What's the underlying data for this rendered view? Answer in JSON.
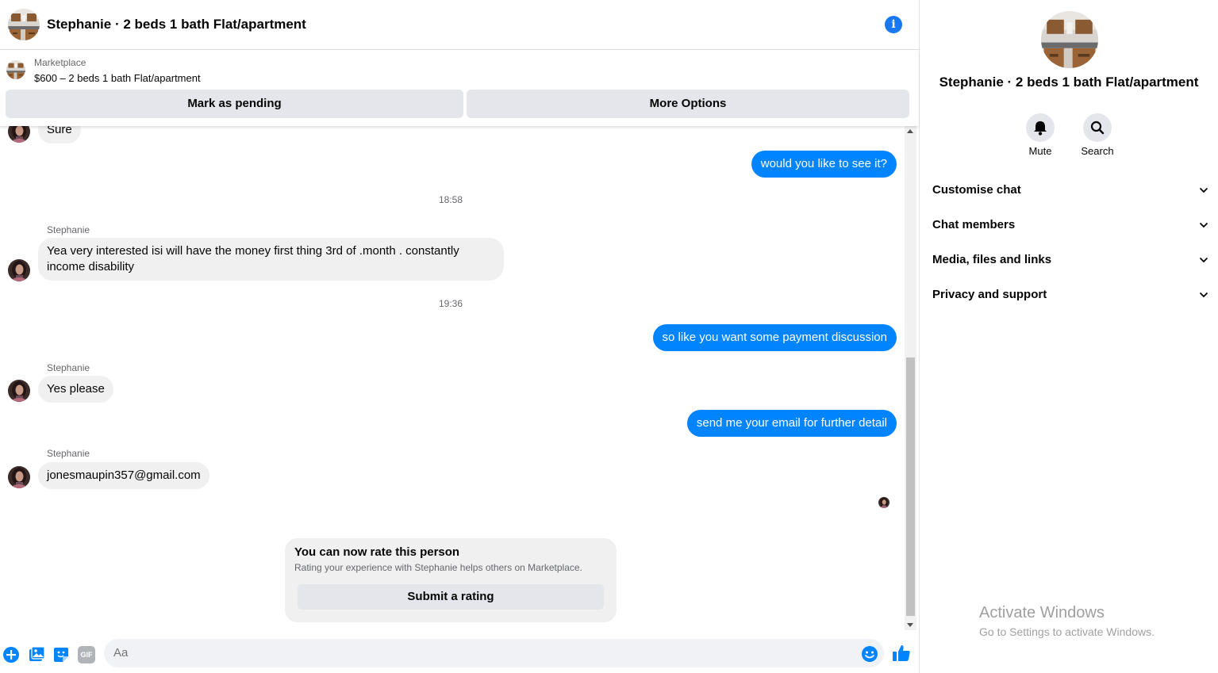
{
  "header": {
    "title": "Stephanie · 2 beds 1 bath Flat/apartment",
    "info_icon": "info-icon"
  },
  "listing": {
    "category": "Marketplace",
    "price_line": "$600 – 2 beds 1 bath Flat/apartment",
    "mark_pending_label": "Mark as pending",
    "more_options_label": "More Options"
  },
  "messages": [
    {
      "direction": "in",
      "text": "Sure"
    },
    {
      "direction": "out",
      "text": "would you like to see it?"
    },
    {
      "type": "time",
      "text": "18:58"
    },
    {
      "direction": "in",
      "sender": "Stephanie",
      "text": "Yea very interested isi will have the money first thing 3rd of .month . constantly income disability"
    },
    {
      "type": "time",
      "text": "19:36"
    },
    {
      "direction": "out",
      "text": "so like you want some payment discussion"
    },
    {
      "direction": "in",
      "sender": "Stephanie",
      "text": "Yes please"
    },
    {
      "direction": "out",
      "text": "send me your email for further detail"
    },
    {
      "direction": "in",
      "sender": "Stephanie",
      "text": "jonesmaupin357@gmail.com"
    }
  ],
  "rating_card": {
    "title": "You can now rate this person",
    "subtitle": "Rating your experience with Stephanie helps others on Marketplace.",
    "button_label": "Submit a rating"
  },
  "composer": {
    "placeholder": "Aa",
    "icons": [
      "plus-circle-icon",
      "photo-icon",
      "sticker-icon",
      "gif-icon",
      "emoji-icon",
      "thumbs-up-icon"
    ],
    "gif_label": "GIF"
  },
  "panel": {
    "title": "Stephanie · 2 beds 1 bath Flat/apartment",
    "actions": [
      {
        "label": "Mute",
        "icon": "bell-icon"
      },
      {
        "label": "Search",
        "icon": "search-icon"
      }
    ],
    "sections": [
      "Customise chat",
      "Chat members",
      "Media, files and links",
      "Privacy and support"
    ]
  },
  "watermark": {
    "title": "Activate Windows",
    "subtitle": "Go to Settings to activate Windows."
  },
  "colors": {
    "accent": "#0084ff",
    "brand_blue": "#1877f2",
    "bubble_in": "#f0f0f0",
    "button_gray": "#e4e6eb",
    "secondary_text": "#65676b"
  }
}
